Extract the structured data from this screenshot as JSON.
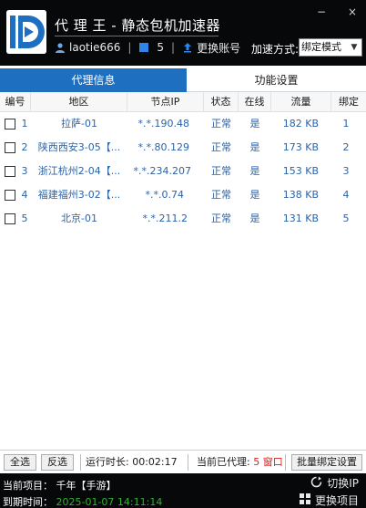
{
  "header": {
    "app_title": "代 理 王 - 静态包机加速器",
    "username": "laotie666",
    "count": "5",
    "switch_account": "更换账号",
    "accel_mode_label": "加速方式:",
    "accel_mode_value": "绑定模式",
    "minimize": "−",
    "close": "×"
  },
  "tabs": [
    {
      "label": "代理信息",
      "active": true
    },
    {
      "label": "功能设置",
      "active": false
    }
  ],
  "table": {
    "columns": [
      "编号",
      "地区",
      "节点IP",
      "状态",
      "在线",
      "流量",
      "绑定"
    ],
    "rows": [
      {
        "no": "1",
        "region": "拉萨-01",
        "ip": "*.*.190.48",
        "status": "正常",
        "online": "是",
        "traffic": "182 KB",
        "bind": "1"
      },
      {
        "no": "2",
        "region": "陕西西安3-05【...",
        "ip": "*.*.80.129",
        "status": "正常",
        "online": "是",
        "traffic": "173 KB",
        "bind": "2"
      },
      {
        "no": "3",
        "region": "浙江杭州2-04【...",
        "ip": "*.*.234.207",
        "status": "正常",
        "online": "是",
        "traffic": "153 KB",
        "bind": "3"
      },
      {
        "no": "4",
        "region": "福建福州3-02【...",
        "ip": "*.*.0.74",
        "status": "正常",
        "online": "是",
        "traffic": "138 KB",
        "bind": "4"
      },
      {
        "no": "5",
        "region": "北京-01",
        "ip": "*.*.211.2",
        "status": "正常",
        "online": "是",
        "traffic": "131 KB",
        "bind": "5"
      }
    ]
  },
  "footer": {
    "select_all": "全选",
    "invert": "反选",
    "runtime_label": "运行时长:",
    "runtime_value": "00:02:17",
    "proxied_label": "当前已代理:",
    "proxied_value": "5 窗口",
    "batch_bind": "批量绑定设置"
  },
  "status": {
    "project_label": "当前项目：",
    "project_value": "千年【手游】",
    "expire_label": "到期时间：",
    "expire_value": "2025-01-07 14:11:14",
    "switch_ip": "切换IP",
    "change_project": "更换项目"
  },
  "colors": {
    "header_bg": "#07080a",
    "accent": "#1f6fc1",
    "link_text": "#2a63a8",
    "runtime_count": "#e21b1b",
    "expire_date": "#2fb02f"
  }
}
